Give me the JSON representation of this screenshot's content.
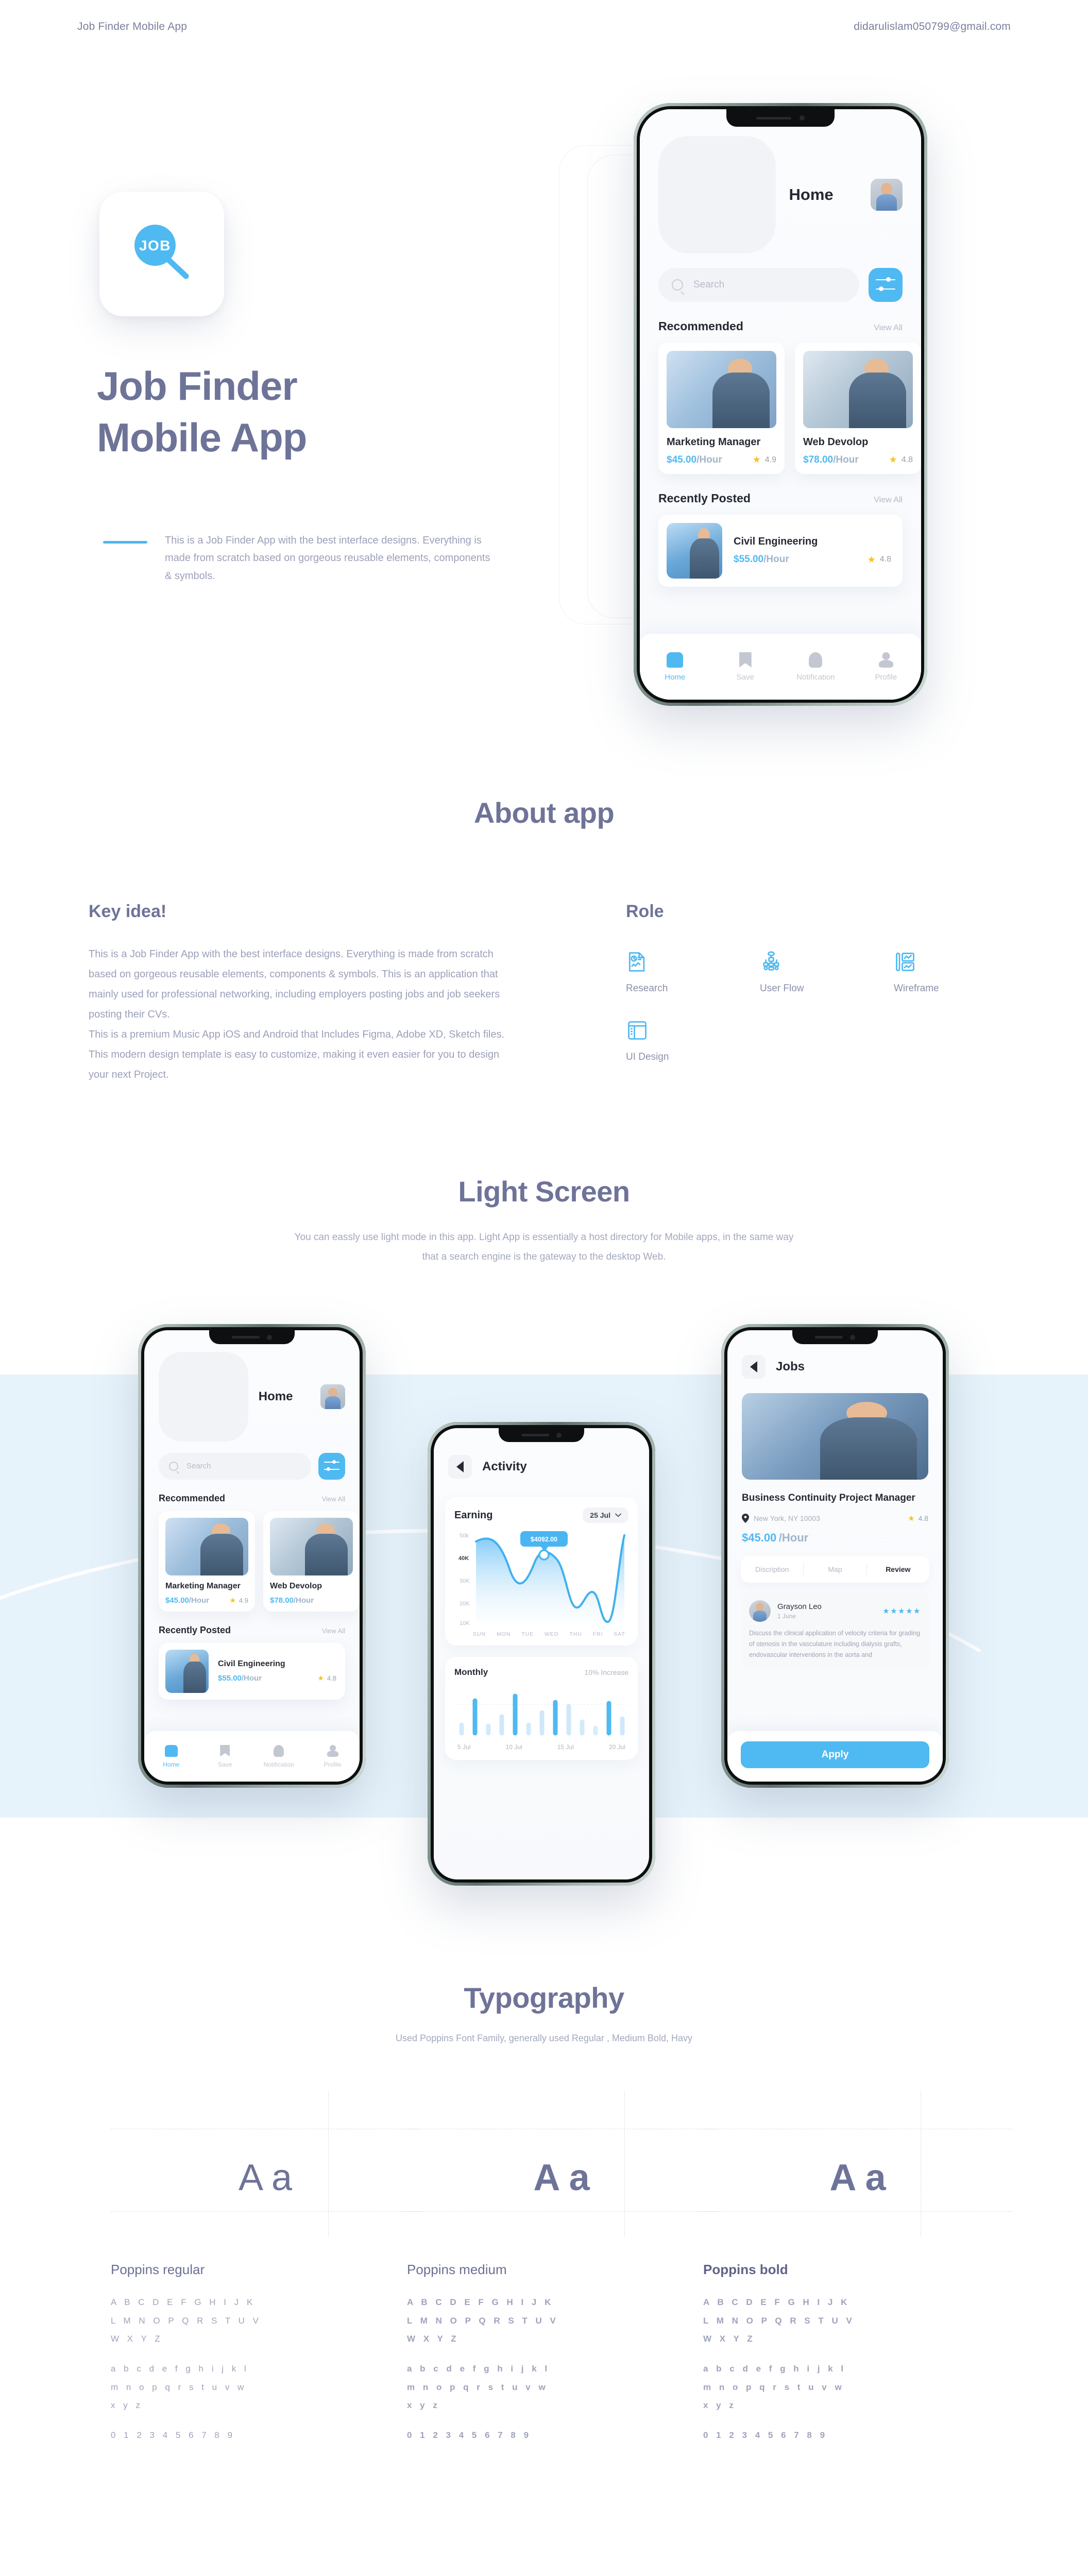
{
  "topbar": {
    "left": "Job Finder Mobile App",
    "right": "didarulislam050799@gmail.com"
  },
  "hero": {
    "logo_text": "JOB",
    "title_line1": "Job Finder",
    "title_line2": "Mobile App",
    "description": "This is a Job Finder App with the best interface designs. Everything is made from scratch based on gorgeous reusable elements, components & symbols."
  },
  "app": {
    "home": {
      "title": "Home",
      "search_placeholder": "Search",
      "recommended_label": "Recommended",
      "recently_label": "Recently Posted",
      "view_all": "View All",
      "recommended": [
        {
          "name": "Marketing Manager",
          "price": "$45.00",
          "unit": "/Hour",
          "rating": "4.9"
        },
        {
          "name": "Web Devolop",
          "price": "$78.00",
          "unit": "/Hour",
          "rating": "4.8"
        }
      ],
      "recent": [
        {
          "name": "Civil Engineering",
          "price": "$55.00",
          "unit": "/Hour",
          "rating": "4.8"
        }
      ],
      "tabs": [
        {
          "label": "Home",
          "icon": "home-icon",
          "active": true
        },
        {
          "label": "Save",
          "icon": "bookmark-icon",
          "active": false
        },
        {
          "label": "Notification",
          "icon": "bell-icon",
          "active": false
        },
        {
          "label": "Profile",
          "icon": "person-icon",
          "active": false
        }
      ]
    },
    "activity": {
      "title": "Activity",
      "earning_label": "Earning",
      "date_filter": "25 Jul",
      "tooltip_value": "$4092.00",
      "monthly_label": "Monthly",
      "monthly_delta": "10% Increase"
    },
    "jobs": {
      "title": "Jobs",
      "job_title": "Business Continuity Project Manager",
      "location": "New York, NY 10003",
      "rating": "4.8",
      "price": "$45.00",
      "unit": "/Hour",
      "tabs": [
        {
          "label": "Discription",
          "active": false
        },
        {
          "label": "Map",
          "active": false
        },
        {
          "label": "Review",
          "active": true
        }
      ],
      "review": {
        "name": "Grayson Leo",
        "date": "1 June",
        "stars": "★★★★★",
        "text": "Discuss the clinical application of velocity criteria for grading of stenosis in the vasculature including dialysis grafts, endovascular interventions in the aorta and"
      },
      "apply_label": "Apply"
    }
  },
  "about": {
    "heading": "About app",
    "key_idea_heading": "Key idea!",
    "key_idea_p1": "This is a Job Finder App with the best interface designs. Everything is made from scratch based on gorgeous reusable elements, components & symbols. This is an application that mainly used for professional networking, including employers posting jobs and job seekers posting their CVs.",
    "key_idea_p2": "This is a premium Music App iOS and Android that Includes Figma, Adobe XD, Sketch files. This modern design template is easy to customize, making it even easier for you to design your next Project.",
    "role_heading": "Role",
    "roles": [
      {
        "label": "Research",
        "icon": "research-document-icon"
      },
      {
        "label": "User Flow",
        "icon": "user-flow-icon"
      },
      {
        "label": "Wireframe",
        "icon": "wireframe-icon"
      },
      {
        "label": "UI Design",
        "icon": "ui-design-icon"
      }
    ]
  },
  "light_screen": {
    "heading": "Light Screen",
    "subtext": "You can eassly use light mode in this app. Light App is essentially a host directory for Mobile apps, in the same way that a search engine is the gateway to the desktop Web."
  },
  "typography": {
    "heading": "Typography",
    "subtext": "Used Poppins Font Family, generally used Regular , Medium Bold, Havy",
    "specimen_glyph": "A a",
    "uppercase_rows": [
      "A B C D E F G H I J K",
      "L M N O P Q R S T U V",
      "W X Y Z"
    ],
    "lowercase_rows": [
      "a b c d e f g h i j k l",
      "m n o p q r s t u v w",
      "x y z"
    ],
    "numerals": "0 1 2 3 4 5 6 7 8 9",
    "styles": [
      {
        "name": "Poppins regular"
      },
      {
        "name": "Poppins medium"
      },
      {
        "name": "Poppins bold"
      }
    ]
  },
  "chart_data": [
    {
      "type": "area",
      "title": "Earning",
      "xlabel": "",
      "ylabel": "",
      "categories": [
        "SUN",
        "MON",
        "TUE",
        "WED",
        "THU",
        "FRI",
        "SAT"
      ],
      "values": [
        46000,
        33000,
        40000,
        24000,
        30000,
        16000,
        50000
      ],
      "ytick_labels": [
        "50k",
        "40K",
        "30K",
        "20K",
        "10K"
      ],
      "ylim": [
        10000,
        50000
      ],
      "annotation": "$4092.00",
      "annotation_index": 2,
      "grid": false,
      "legend": "none"
    },
    {
      "type": "bar",
      "title": "Monthly",
      "subtitle": "10% Increase",
      "categories": [
        "5 Jul",
        "",
        "",
        "",
        "10 Jul",
        "",
        "",
        "15 Jul",
        "",
        "",
        "",
        "20 Jul",
        ""
      ],
      "values": [
        18,
        62,
        16,
        34,
        74,
        18,
        42,
        60,
        48,
        22,
        12,
        58,
        30
      ],
      "highlight_indices": [
        1,
        4,
        7,
        11
      ],
      "xtick_labels": [
        "5 Jul",
        "10 Jul",
        "15 Jul",
        "20 Jul"
      ],
      "grid": true,
      "legend": "none"
    }
  ],
  "colors": {
    "accent": "#4fb9f2",
    "heading": "#6e7398",
    "body": "#9ca0b8",
    "band": "#e7f3fb",
    "star": "#f8c21c"
  }
}
